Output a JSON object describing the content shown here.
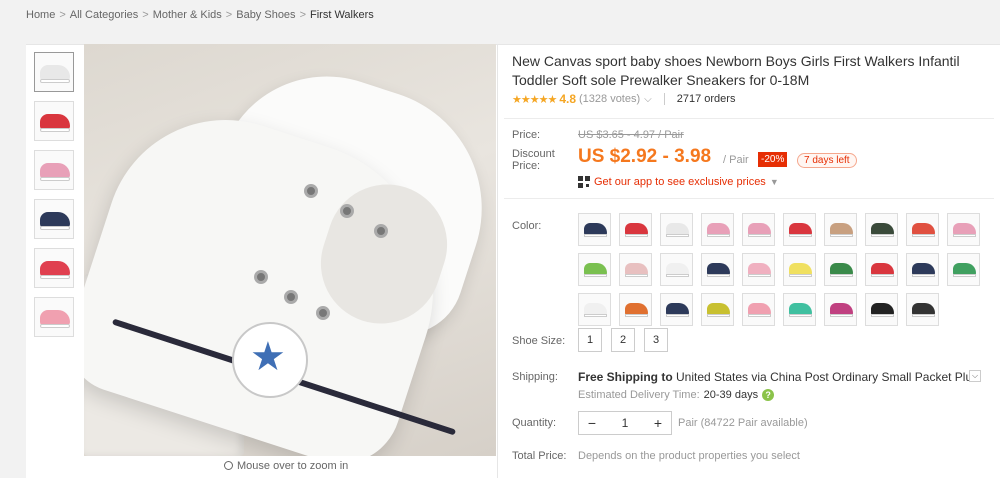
{
  "breadcrumb": {
    "items": [
      "Home",
      "All Categories",
      "Mother & Kids",
      "Baby Shoes",
      "First Walkers"
    ],
    "separator": ">"
  },
  "gallery": {
    "thumbnail_colors": [
      "#e8e8e8",
      "#d9363e",
      "#e8a0b8",
      "#2d3a5a",
      "#e04050",
      "#f0a0b0"
    ],
    "zoom_hint": "Mouse over to zoom in",
    "zoom_icon": "magnifier-icon"
  },
  "product": {
    "title": "New Canvas sport baby shoes Newborn Boys Girls First Walkers Infantil Toddler Soft sole Prewalker Sneakers for 0-18M",
    "stars": "★★★★★",
    "rating": "4.8",
    "votes": "(1328 votes)",
    "orders": "2717 orders"
  },
  "pricing": {
    "price_label": "Price:",
    "original_price": "US $3.65 - 4.97 / Pair",
    "discount_label": "Discount Price:",
    "discount_price": "US $2.92 - 3.98",
    "unit": "/ Pair",
    "discount_badge": "-20%",
    "days_left": "7 days left",
    "app_promo": "Get our app to see exclusive prices",
    "accent": "#f5781e",
    "sale_red": "#e62e04"
  },
  "options": {
    "color_label": "Color:",
    "color_swatches": [
      "#2d3a5a",
      "#d9363e",
      "#e8e8e8",
      "#e8a0b8",
      "#e8a0b8",
      "#d9363e",
      "#c8a080",
      "#3a4a3a",
      "#e05040",
      "#e8a0b8",
      "#7ac050",
      "#e8c0c0",
      "#f0f0f0",
      "#2d3a5a",
      "#f0b0c0",
      "#f0e060",
      "#3a8a4a",
      "#d9363e",
      "#2d3a5a",
      "#40a060",
      "#f0f0f0",
      "#e07030",
      "#2d3a5a",
      "#c8c030",
      "#f0a0b0",
      "#40c0a0",
      "#c04080",
      "#222222",
      "#333333"
    ],
    "size_label": "Shoe Size:",
    "sizes": [
      "1",
      "2",
      "3"
    ]
  },
  "shipping": {
    "label": "Shipping:",
    "free_text": "Free Shipping to",
    "destination": "United States via China Post Ordinary Small Packet Plus",
    "estimate_label": "Estimated Delivery Time:",
    "estimate_days": "20-39 days",
    "help_icon": "?"
  },
  "quantity": {
    "label": "Quantity:",
    "minus": "−",
    "value": "1",
    "plus": "+",
    "available": "Pair (84722 Pair available)"
  },
  "total": {
    "label": "Total Price:",
    "note": "Depends on the product properties you select"
  }
}
